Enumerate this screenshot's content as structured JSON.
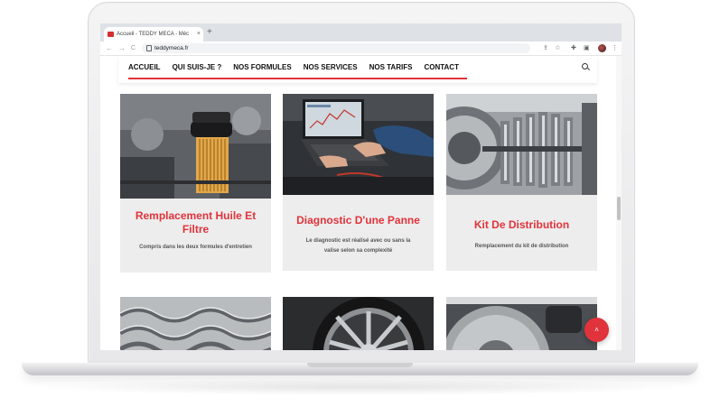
{
  "browser": {
    "tab_title": "Accueil - TEDDY MECA - Méc",
    "tab_close": "×",
    "new_tab": "+",
    "url": "teddymeca.fr",
    "back": "←",
    "forward": "→",
    "reload": "C"
  },
  "site": {
    "nav": [
      "ACCUEIL",
      "QUI SUIS-JE ?",
      "NOS FORMULES",
      "NOS SERVICES",
      "NOS TARIFS",
      "CONTACT"
    ],
    "accent_color": "#e1333b"
  },
  "services": [
    {
      "title": "Remplacement Huile Et Filtre",
      "description": "Compris dans les deux formules d'entretien",
      "image": "oil-filter-photo"
    },
    {
      "title": "Diagnostic D'une Panne",
      "description": "Le diagnostic est réalisé avec ou sans la valise selon sa complexité",
      "image": "diagnostic-laptop-photo"
    },
    {
      "title": "Kit De Distribution",
      "description": "Remplacement du kit de distribution",
      "image": "timing-belt-photo"
    }
  ],
  "services_row2": [
    {
      "image": "suspension-springs-photo"
    },
    {
      "image": "alloy-wheel-photo"
    },
    {
      "image": "brake-disc-photo"
    }
  ],
  "back_to_top": "˄"
}
